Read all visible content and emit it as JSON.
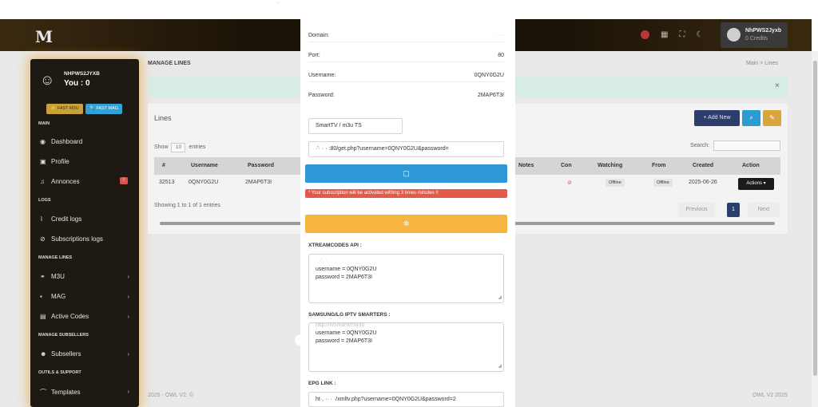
{
  "top": {
    "dot": "·"
  },
  "navbar": {
    "logo": "M",
    "user_name": "NhPWS2Jyxb",
    "user_credits": "0 Credits",
    "icons": [
      "flag-icon",
      "grid-icon",
      "fullscreen-icon",
      "moon-icon"
    ]
  },
  "sidebar": {
    "user": "NHPWS2JYXB",
    "you": "You : 0",
    "fast_m3u": "⚡ FAST M3U",
    "fast_mag": "🔍 FAST MAG",
    "sections": {
      "main": "MAIN",
      "logs": "LOGS",
      "manage_lines": "MANAGE LINES",
      "manage_subsellers": "MANAGE SUBSELLERS",
      "outils": "OUTILS & SUPPORT"
    },
    "items": {
      "dashboard": "Dashboard",
      "profile": "Profile",
      "annonces": "Annonces",
      "annonces_badge": "!",
      "credit_logs": "Credit logs",
      "subscriptions_logs": "Subscriptions logs",
      "m3u": "M3U",
      "mag": "MAG",
      "active_codes": "Active Codes",
      "subsellers": "Subsellers",
      "templates": "Templates"
    }
  },
  "main": {
    "page_title": "MANAGE LINES",
    "breadcrumb": "Main  >  Lines",
    "alert_close": "×",
    "card_title": "Lines",
    "add_new": "+ Add New",
    "show_label": "Show",
    "show_value": "10",
    "entries_label": "entries",
    "search_label": "Search:",
    "columns": [
      "#",
      "Username",
      "Password",
      "Notes",
      "Con",
      "Watching",
      "From",
      "Created",
      "Action"
    ],
    "row": {
      "id": "32513",
      "username": "0QNY0G2U",
      "password": "2MAP6T3I",
      "con": "⊘",
      "watching": "Offline",
      "from": "Offline",
      "created": "2025-06-26",
      "action": "Actions ▾"
    },
    "showing": "Showing 1 to 1 of 1 entries",
    "previous": "Previous",
    "page": "1",
    "next": "Next",
    "footer_left": "2025 - OWL V2. ©",
    "footer_right": "OWL V2 2025"
  },
  "modal": {
    "domain_label": "Domain:",
    "domain_value": "·  ·   ·",
    "port_label": "Port:",
    "port_value": "80",
    "username_label": "Username:",
    "username_value": "0QNY0G2U",
    "password_label": "Password:",
    "password_value": "2MAP6T3I",
    "format_select": "SmartTV / m3u TS",
    "url_value": "·'·  ·  · :80/get.php?username=0QNY0G2U&password=",
    "copy_icon": "▢",
    "warning": "* Your subscription will be activated withing 3 times minutes !!",
    "share_icon": "✲",
    "xtream_label": "XTREAMCODES API :",
    "xtream_line1": "·  ·'·  ·",
    "xtream_line2": "username = 0QNY0G2U",
    "xtream_line3": "password = 2MAP6T3I",
    "samsung_label": "SAMSUNG/LG IPTV SMARTERS :",
    "samsung_line1": "http://tvsmartersinfo",
    "samsung_line2": "username = 0QNY0G2U",
    "samsung_line3": "password = 2MAP6T3I",
    "epg_label": "EPG LINK :",
    "epg_value": "ht·, ·· · ·/xmltv.php?username=0QNY0G2U&password=2"
  }
}
